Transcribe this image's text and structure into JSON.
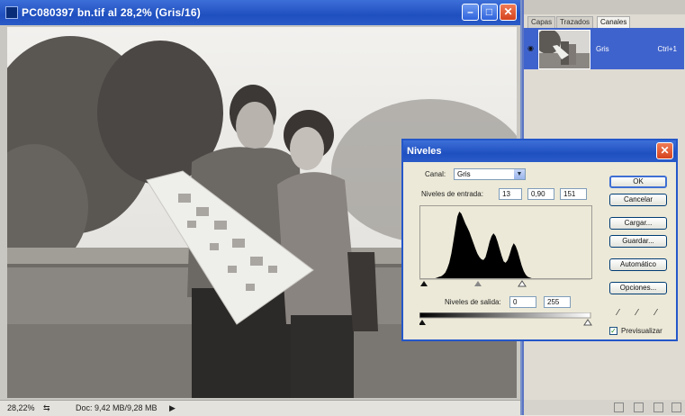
{
  "document": {
    "title": "PC080397 bn.tif al 28,2% (Gris/16)",
    "status_zoom": "28,22%",
    "status_doc": "Doc: 9,42 MB/9,28 MB"
  },
  "panel": {
    "tabs": [
      "Capas",
      "Trazados",
      "Canales"
    ],
    "channel": {
      "name": "Gris",
      "shortcut": "Ctrl+1"
    }
  },
  "levels": {
    "title": "Niveles",
    "canal_label": "Canal:",
    "canal_value": "Gris",
    "input_label": "Niveles de entrada:",
    "input_black": "13",
    "input_gamma": "0,90",
    "input_white": "151",
    "output_label": "Niveles de salida:",
    "output_black": "0",
    "output_white": "255",
    "buttons": {
      "ok": "OK",
      "cancel": "Cancelar",
      "load": "Cargar...",
      "save": "Guardar...",
      "auto": "Automático",
      "options": "Opciones..."
    },
    "preview_label": "Previsualizar",
    "preview_checked": true,
    "histogram": [
      0,
      0,
      0,
      1,
      2,
      3,
      5,
      8,
      14,
      22,
      35,
      52,
      70,
      88,
      95,
      92,
      85,
      78,
      72,
      66,
      58,
      50,
      42,
      35,
      30,
      27,
      26,
      30,
      40,
      52,
      60,
      64,
      60,
      52,
      42,
      32,
      24,
      22,
      26,
      34,
      44,
      50,
      46,
      38,
      28,
      18,
      10,
      5,
      2,
      1,
      0,
      0,
      0,
      0,
      0,
      0
    ]
  }
}
